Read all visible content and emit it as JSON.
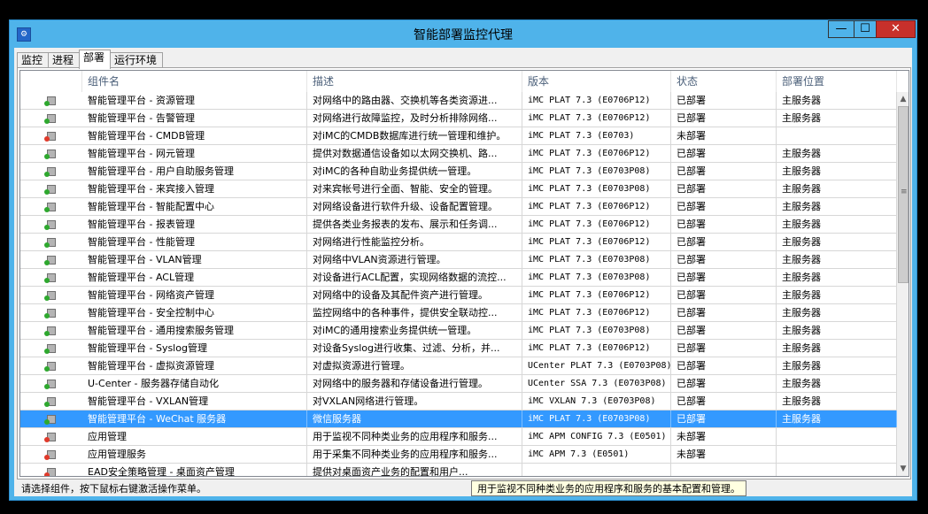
{
  "window": {
    "title": "智能部署监控代理",
    "minimize_label": "—",
    "maximize_label": "☐",
    "close_label": "✕",
    "colors": {
      "titlebar": "#4fb3ea",
      "close": "#c7302b",
      "selection": "#3399ff"
    }
  },
  "tabs": [
    {
      "label": "监控",
      "active": false
    },
    {
      "label": "进程",
      "active": false
    },
    {
      "label": "部署",
      "active": true
    },
    {
      "label": "运行环境",
      "active": false
    }
  ],
  "table": {
    "headers": [
      "",
      "组件名",
      "描述",
      "版本",
      "状态",
      "部署位置"
    ],
    "rows": [
      {
        "status_icon": "green",
        "name": "智能管理平台 - 资源管理",
        "desc": "对网络中的路由器、交换机等各类资源进...",
        "version": "iMC PLAT 7.3 (E0706P12)",
        "state": "已部署",
        "location": "主服务器"
      },
      {
        "status_icon": "green",
        "name": "智能管理平台 - 告警管理",
        "desc": "对网络进行故障监控，及时分析排除网络...",
        "version": "iMC PLAT 7.3 (E0706P12)",
        "state": "已部署",
        "location": "主服务器"
      },
      {
        "status_icon": "red",
        "name": "智能管理平台 - CMDB管理",
        "desc": "对iMC的CMDB数据库进行统一管理和维护。",
        "version": "iMC PLAT 7.3 (E0703)",
        "state": "未部署",
        "location": ""
      },
      {
        "status_icon": "green",
        "name": "智能管理平台 - 网元管理",
        "desc": "提供对数据通信设备如以太网交换机、路...",
        "version": "iMC PLAT 7.3 (E0706P12)",
        "state": "已部署",
        "location": "主服务器"
      },
      {
        "status_icon": "green",
        "name": "智能管理平台 - 用户自助服务管理",
        "desc": "对iMC的各种自助业务提供统一管理。",
        "version": "iMC PLAT 7.3 (E0703P08)",
        "state": "已部署",
        "location": "主服务器"
      },
      {
        "status_icon": "green",
        "name": "智能管理平台 - 来宾接入管理",
        "desc": "对来宾帐号进行全面、智能、安全的管理。",
        "version": "iMC PLAT 7.3 (E0703P08)",
        "state": "已部署",
        "location": "主服务器"
      },
      {
        "status_icon": "green",
        "name": "智能管理平台 - 智能配置中心",
        "desc": "对网络设备进行软件升级、设备配置管理。",
        "version": "iMC PLAT 7.3 (E0706P12)",
        "state": "已部署",
        "location": "主服务器"
      },
      {
        "status_icon": "green",
        "name": "智能管理平台 - 报表管理",
        "desc": "提供各类业务报表的发布、展示和任务调...",
        "version": "iMC PLAT 7.3 (E0706P12)",
        "state": "已部署",
        "location": "主服务器"
      },
      {
        "status_icon": "green",
        "name": "智能管理平台 - 性能管理",
        "desc": "对网络进行性能监控分析。",
        "version": "iMC PLAT 7.3 (E0706P12)",
        "state": "已部署",
        "location": "主服务器"
      },
      {
        "status_icon": "green",
        "name": "智能管理平台 - VLAN管理",
        "desc": "对网络中VLAN资源进行管理。",
        "version": "iMC PLAT 7.3 (E0703P08)",
        "state": "已部署",
        "location": "主服务器"
      },
      {
        "status_icon": "green",
        "name": "智能管理平台 - ACL管理",
        "desc": "对设备进行ACL配置，实现网络数据的流控...",
        "version": "iMC PLAT 7.3 (E0703P08)",
        "state": "已部署",
        "location": "主服务器"
      },
      {
        "status_icon": "green",
        "name": "智能管理平台 - 网络资产管理",
        "desc": "对网络中的设备及其配件资产进行管理。",
        "version": "iMC PLAT 7.3 (E0706P12)",
        "state": "已部署",
        "location": "主服务器"
      },
      {
        "status_icon": "green",
        "name": "智能管理平台 - 安全控制中心",
        "desc": "监控网络中的各种事件，提供安全联动控...",
        "version": "iMC PLAT 7.3 (E0706P12)",
        "state": "已部署",
        "location": "主服务器"
      },
      {
        "status_icon": "green",
        "name": "智能管理平台 - 通用搜索服务管理",
        "desc": "对iMC的通用搜索业务提供统一管理。",
        "version": "iMC PLAT 7.3 (E0703P08)",
        "state": "已部署",
        "location": "主服务器"
      },
      {
        "status_icon": "green",
        "name": "智能管理平台 - Syslog管理",
        "desc": "对设备Syslog进行收集、过滤、分析，并...",
        "version": "iMC PLAT 7.3 (E0706P12)",
        "state": "已部署",
        "location": "主服务器"
      },
      {
        "status_icon": "green",
        "name": "智能管理平台 - 虚拟资源管理",
        "desc": "对虚拟资源进行管理。",
        "version": "UCenter PLAT 7.3 (E0703P08)",
        "state": "已部署",
        "location": "主服务器"
      },
      {
        "status_icon": "green",
        "name": "U-Center - 服务器存储自动化",
        "desc": "对网络中的服务器和存储设备进行管理。",
        "version": "UCenter SSA 7.3 (E0703P08)",
        "state": "已部署",
        "location": "主服务器"
      },
      {
        "status_icon": "green",
        "name": "智能管理平台 - VXLAN管理",
        "desc": "对VXLAN网络进行管理。",
        "version": "iMC VXLAN 7.3 (E0703P08)",
        "state": "已部署",
        "location": "主服务器"
      },
      {
        "status_icon": "green",
        "name": "智能管理平台 - WeChat 服务器",
        "desc": "微信服务器",
        "version": "iMC PLAT 7.3 (E0703P08)",
        "state": "已部署",
        "location": "主服务器",
        "selected": true
      },
      {
        "status_icon": "red",
        "name": "应用管理",
        "desc": "用于监视不同种类业务的应用程序和服务...",
        "version": "iMC APM CONFIG 7.3 (E0501)",
        "state": "未部署",
        "location": ""
      },
      {
        "status_icon": "red",
        "name": "应用管理服务",
        "desc": "用于采集不同种类业务的应用程序和服务...",
        "version": "iMC APM 7.3 (E0501)",
        "state": "未部署",
        "location": ""
      },
      {
        "status_icon": "red",
        "name": "EAD安全策略管理 - 桌面资产管理",
        "desc": "提供对桌面资产业务的配置和用户...",
        "version": "",
        "state": "",
        "location": ""
      }
    ]
  },
  "tooltip": "用于监视不同种类业务的应用程序和服务的基本配置和管理。",
  "statusbar": "请选择组件，按下鼠标右键激活操作菜单。"
}
